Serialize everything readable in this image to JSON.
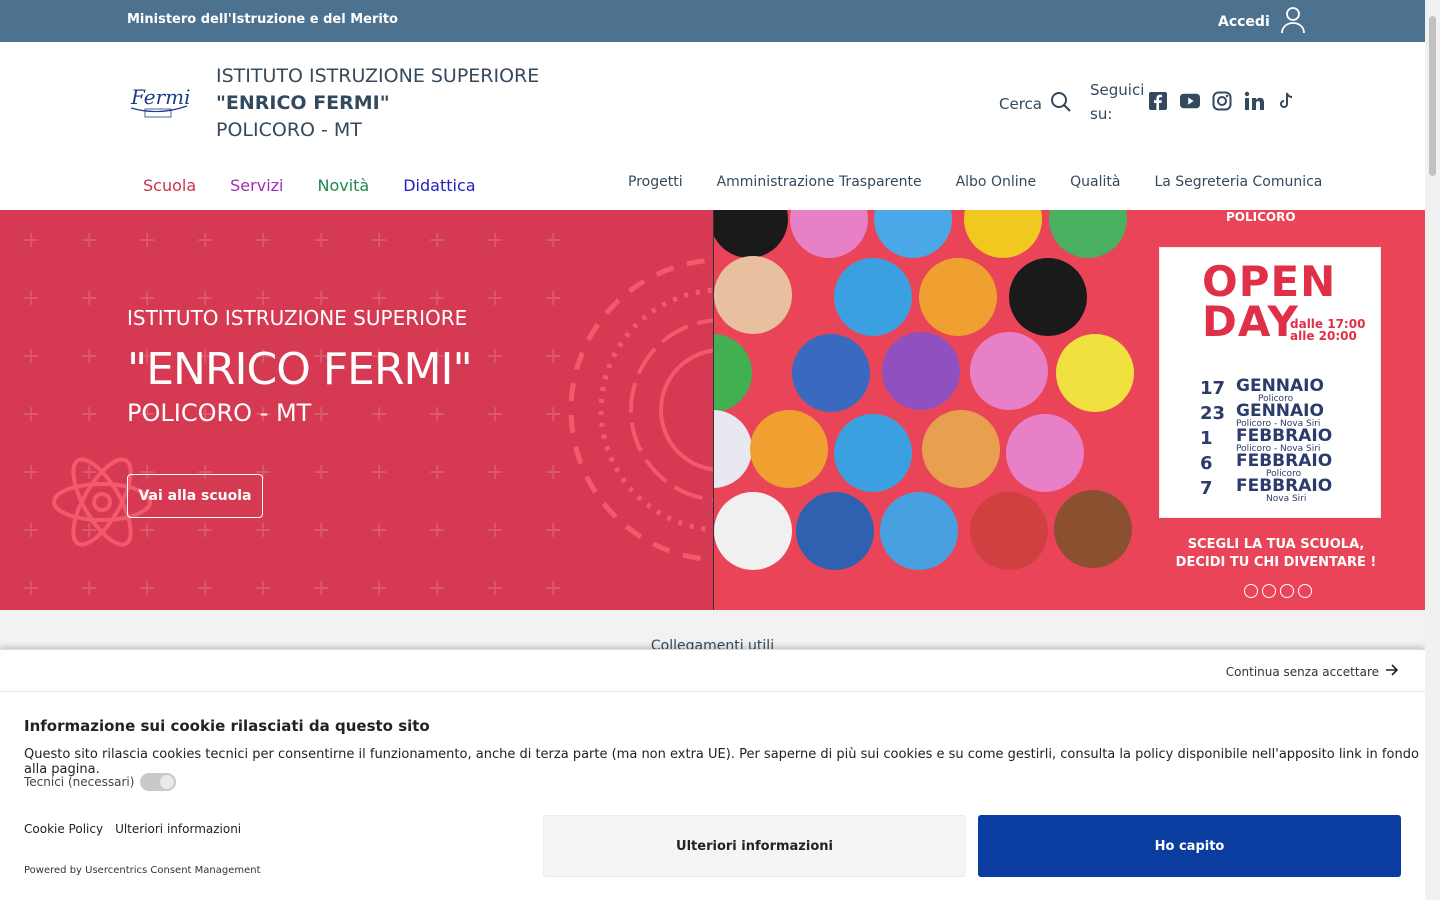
{
  "topbar": {
    "ministry": "Ministero dell'Istruzione e del Merito",
    "login": "Accedi",
    "login_icon": "user-icon"
  },
  "header": {
    "school_line1": "ISTITUTO ISTRUZIONE SUPERIORE",
    "school_line2": "\"ENRICO FERMI\"",
    "school_line3": "POLICORO - MT",
    "search_label": "Cerca",
    "follow_label": "Seguici su:",
    "socials": [
      "facebook-icon",
      "youtube-icon",
      "instagram-icon",
      "linkedin-icon",
      "tiktok-icon"
    ]
  },
  "nav": {
    "main": [
      "Scuola",
      "Servizi",
      "Novità",
      "Didattica"
    ],
    "secondary": [
      "Progetti",
      "Amministrazione Trasparente",
      "Albo Online",
      "Qualità",
      "La Segreteria Comunica"
    ]
  },
  "hero": {
    "line1": "ISTITUTO ISTRUZIONE SUPERIORE",
    "line2": "\"ENRICO FERMI\"",
    "line3": "POLICORO - MT",
    "button": "Vai alla scuola",
    "banner": {
      "logo_text": "POLICORO",
      "title1": "OPEN",
      "title2": "DAY",
      "time1": "dalle 17:00",
      "time2": "alle  20:00",
      "dates": [
        {
          "day": "17",
          "month": "GENNAIO",
          "city": "Policoro"
        },
        {
          "day": "23",
          "month": "GENNAIO",
          "city": "Policoro - Nova Siri"
        },
        {
          "day": "1",
          "month": "FEBBRAIO",
          "city": "Policoro - Nova Siri"
        },
        {
          "day": "6",
          "month": "FEBBRAIO",
          "city": "Policoro"
        },
        {
          "day": "7",
          "month": "FEBBRAIO",
          "city": "Nova Siri"
        }
      ],
      "slogan1": "SCEGLI  LA TUA SCUOLA,",
      "slogan2": "DECIDI TU CHI DIVENTARE !"
    }
  },
  "useful_links": "Collegamenti utili",
  "cookie": {
    "continue": "Continua senza accettare",
    "title": "Informazione sui cookie rilasciati da questo sito",
    "description": "Questo sito rilascia cookies tecnici per consentirne il funzionamento, anche di terza parte (ma non extra UE). Per saperne di più sui cookies e su come gestirli, consulta la policy disponibile nell'apposito link in fondo alla pagina.",
    "technical": "Tecnici (necessari)",
    "link_policy": "Cookie Policy",
    "link_more": "Ulteriori informazioni",
    "powered": "Powered by Usercentrics Consent Management",
    "btn_more": "Ulteriori informazioni",
    "btn_ok": "Ho capito"
  }
}
